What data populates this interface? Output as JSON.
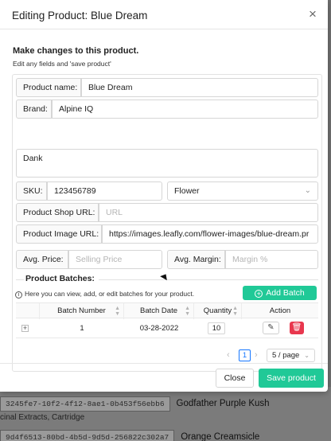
{
  "modal": {
    "title": "Editing Product: Blue Dream",
    "close_icon": "close-icon",
    "lead": "Make changes to this product.",
    "sub": "Edit any fields and 'save product'"
  },
  "form": {
    "product_name_label": "Product name:",
    "product_name_value": "Blue Dream",
    "brand_label": "Brand:",
    "brand_value": "Alpine IQ",
    "description_value": "Dank",
    "sku_label": "SKU:",
    "sku_value": "123456789",
    "category_value": "Flower",
    "shop_url_label": "Product Shop URL:",
    "shop_url_placeholder": "URL",
    "image_url_label": "Product Image URL:",
    "image_url_value": "https://images.leafly.com/flower-images/blue-dream.pr",
    "avg_price_label": "Avg. Price:",
    "avg_price_placeholder": "Selling Price",
    "avg_margin_label": "Avg. Margin:",
    "avg_margin_placeholder": "Margin %"
  },
  "batches": {
    "title": "Product Batches:",
    "info": "Here you can view, add, or edit batches for your product.",
    "add_label": "Add Batch",
    "columns": [
      "Batch Number",
      "Batch Date",
      "Quantity",
      "Action"
    ],
    "rows": [
      {
        "expand": "+",
        "batch_number": "1",
        "batch_date": "03-28-2022",
        "quantity": "10"
      }
    ],
    "pagination": {
      "current": "1",
      "page_size": "5 / page"
    }
  },
  "footer": {
    "close_label": "Close",
    "save_label": "Save product"
  },
  "background": {
    "row1_id": "3245fe7-10f2-4f12-8ae1-0b453f56ebb6",
    "row1_name": "Godfather Purple Kush",
    "row1_sub": "cinal Extracts, Cartridge",
    "row2_id": "9d4f6513-80bd-4b5d-9d5d-256822c302a7",
    "row2_name": "Orange Creamsicle"
  },
  "colors": {
    "accent": "#20c997",
    "danger": "#e8374e",
    "link": "#1677ff"
  }
}
